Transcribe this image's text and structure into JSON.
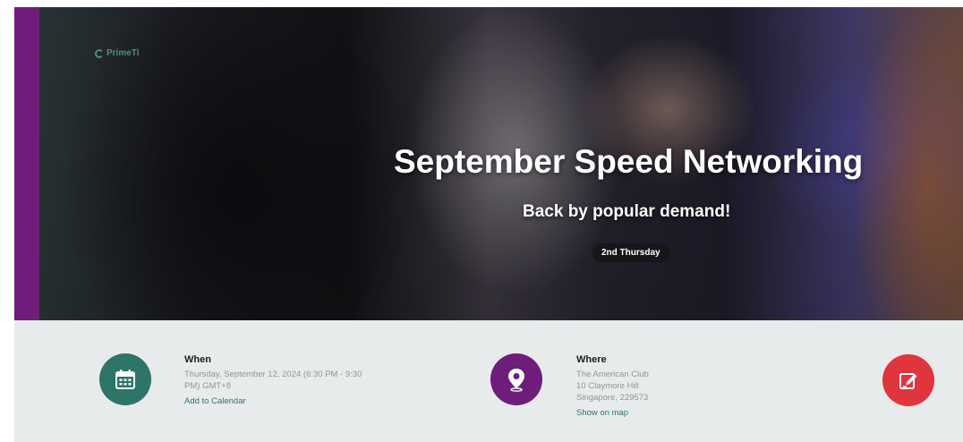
{
  "hero": {
    "brand_text": "PrimeTi",
    "title": "September Speed Networking",
    "subtitle": "Back by popular demand!",
    "badge": "2nd Thursday"
  },
  "when": {
    "icon": "calendar-icon",
    "heading": "When",
    "date_line1": "Thursday, September 12, 2024 (6:30 PM - 9:30",
    "date_line2": "PM) GMT+8",
    "link": "Add to Calendar"
  },
  "where": {
    "icon": "location-pin-icon",
    "heading": "Where",
    "venue": "The American Club",
    "street": "10 Claymore Hill",
    "city": "Singapore, 229573",
    "link": "Show on map"
  },
  "register": {
    "icon": "edit-form-icon"
  },
  "colors": {
    "accent_purple": "#6e1d7a",
    "accent_green": "#2c7568",
    "accent_red": "#e0353c",
    "info_bg": "#e8ebeb"
  }
}
